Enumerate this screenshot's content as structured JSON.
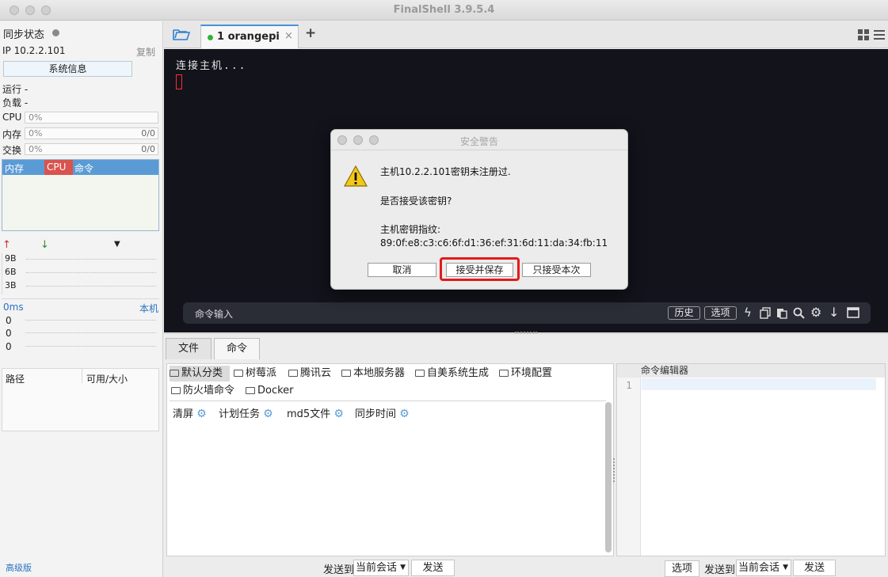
{
  "app": {
    "title": "FinalShell 3.9.5.4"
  },
  "left": {
    "sync_label": "同步状态",
    "ip": "IP 10.2.2.101",
    "copy": "复制",
    "sysinfo_btn": "系统信息",
    "run_label": "运行 -",
    "load_label": "负载 -",
    "cpu": {
      "label": "CPU",
      "value": "0%"
    },
    "mem": {
      "label": "内存",
      "value": "0%",
      "right": "0/0"
    },
    "swap": {
      "label": "交换",
      "value": "0%",
      "right": "0/0"
    },
    "proc_headers": [
      "内存",
      "CPU",
      "命令"
    ],
    "net_ticks": [
      "9B",
      "6B",
      "3B"
    ],
    "latency": {
      "label": "0ms",
      "local": "本机",
      "values": [
        "0",
        "0",
        "0"
      ]
    },
    "path_headers": [
      "路径",
      "可用/大小"
    ],
    "advanced": "高级版"
  },
  "tabs": {
    "session_label": "1 orangepi",
    "close": "×",
    "add": "+"
  },
  "terminal": {
    "line1": "连接主机...",
    "cmd_placeholder": "命令输入",
    "history_btn": "历史",
    "options_btn": "选项"
  },
  "dialog": {
    "title": "安全警告",
    "line1": "主机10.2.2.101密钥未注册过.",
    "line2": "是否接受该密钥?",
    "line3": "主机密钥指纹:",
    "fingerprint": "89:0f:e8:c3:c6:6f:d1:36:ef:31:6d:11:da:34:fb:11",
    "btn_cancel": "取消",
    "btn_accept_save": "接受并保存",
    "btn_accept_once": "只接受本次"
  },
  "bottom": {
    "tab_files": "文件",
    "tab_commands": "命令",
    "categories": [
      "默认分类",
      "树莓派",
      "腾讯云",
      "本地服务器",
      "自美系统生成",
      "环境配置",
      "防火墙命令",
      "Docker"
    ],
    "commands": [
      "清屏",
      "计划任务",
      "md5文件",
      "同步时间"
    ],
    "editor_title": "命令编辑器",
    "editor_line": "1",
    "send_to": "发送到",
    "current_session": "当前会话",
    "send": "发送",
    "options": "选项"
  }
}
